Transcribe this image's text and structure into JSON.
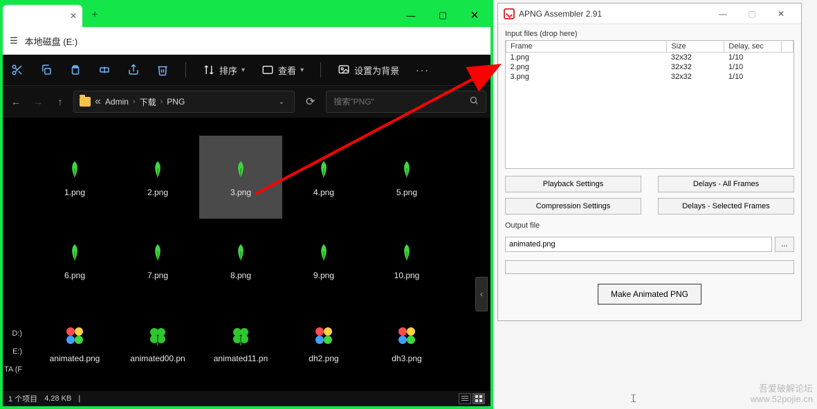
{
  "explorer": {
    "title_path": "本地磁盘 (E:)",
    "toolbar": {
      "sort": "排序",
      "view": "查看",
      "wallpaper": "设置为背景"
    },
    "breadcrumb": {
      "prefix": "«",
      "p1": "Admin",
      "p2": "下载",
      "p3": "PNG"
    },
    "search_placeholder": "搜索\"PNG\"",
    "side": {
      "d": "D:)",
      "e": "E:)",
      "f": "TA (F"
    },
    "files": [
      {
        "name": "1.png",
        "kind": "leaf"
      },
      {
        "name": "2.png",
        "kind": "leaf"
      },
      {
        "name": "3.png",
        "kind": "leaf",
        "selected": true
      },
      {
        "name": "4.png",
        "kind": "leaf"
      },
      {
        "name": "5.png",
        "kind": "leaf"
      },
      {
        "name": "6.png",
        "kind": "leaf"
      },
      {
        "name": "7.png",
        "kind": "leaf"
      },
      {
        "name": "8.png",
        "kind": "leaf"
      },
      {
        "name": "9.png",
        "kind": "leaf"
      },
      {
        "name": "10.png",
        "kind": "leaf"
      },
      {
        "name": "animated.png",
        "kind": "multi"
      },
      {
        "name": "animated00.pn",
        "kind": "clover"
      },
      {
        "name": "animated11.pn",
        "kind": "clover"
      },
      {
        "name": "dh2.png",
        "kind": "multi"
      },
      {
        "name": "dh3.png",
        "kind": "multi"
      }
    ],
    "status": {
      "count": "1 个项目",
      "size": "4.28 KB"
    }
  },
  "apng": {
    "title": "APNG Assembler 2.91",
    "input_label": "Input files (drop here)",
    "col_frame": "Frame",
    "col_size": "Size",
    "col_delay": "Delay, sec",
    "rows": [
      {
        "frame": "1.png",
        "size": "32x32",
        "delay": "1/10"
      },
      {
        "frame": "2.png",
        "size": "32x32",
        "delay": "1/10"
      },
      {
        "frame": "3.png",
        "size": "32x32",
        "delay": "1/10"
      }
    ],
    "btn_playback": "Playback Settings",
    "btn_delays_all": "Delays - All Frames",
    "btn_compression": "Compression Settings",
    "btn_delays_sel": "Delays - Selected Frames",
    "output_label": "Output file",
    "output_value": "animated.png",
    "browse": "...",
    "make": "Make Animated PNG"
  },
  "watermark": {
    "l1": "吾爱破解论坛",
    "l2": "www.52pojie.cn"
  }
}
